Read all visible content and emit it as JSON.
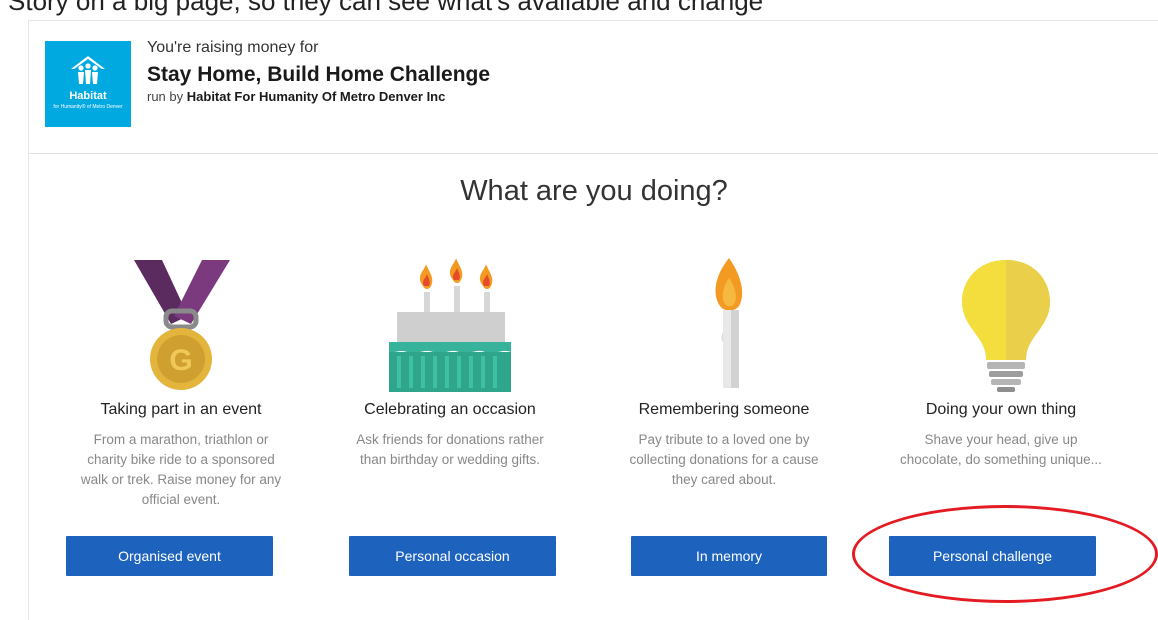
{
  "top_strip": {
    "text": "Story on a big page, so they can see what's available and change"
  },
  "header": {
    "logo": {
      "brand": "Habitat",
      "brand_sub": "for Humanity® of Metro Denver"
    },
    "raising_text": "You're raising money for",
    "campaign_title": "Stay Home, Build Home Challenge",
    "run_by_prefix": "run by",
    "organizer": "Habitat For Humanity Of Metro Denver Inc"
  },
  "question": "What are you doing?",
  "options": [
    {
      "icon": "medal-icon",
      "title": "Taking part in an event",
      "description": "From a marathon, triathlon or charity bike ride to a sponsored walk or trek. Raise money for any official event.",
      "button": "Organised event"
    },
    {
      "icon": "birthday-cake-icon",
      "title": "Celebrating an occasion",
      "description": "Ask friends for donations rather than birthday or wedding gifts.",
      "button": "Personal occasion"
    },
    {
      "icon": "candle-icon",
      "title": "Remembering someone",
      "description": "Pay tribute to a loved one by collecting donations for a cause they cared about.",
      "button": "In memory"
    },
    {
      "icon": "lightbulb-icon",
      "title": "Doing your own thing",
      "description": "Shave your head, give up chocolate, do something unique...",
      "button": "Personal challenge"
    }
  ],
  "colors": {
    "button": "#1d63be",
    "logo_bg": "#00a9e0",
    "highlight": "#e41b23"
  }
}
